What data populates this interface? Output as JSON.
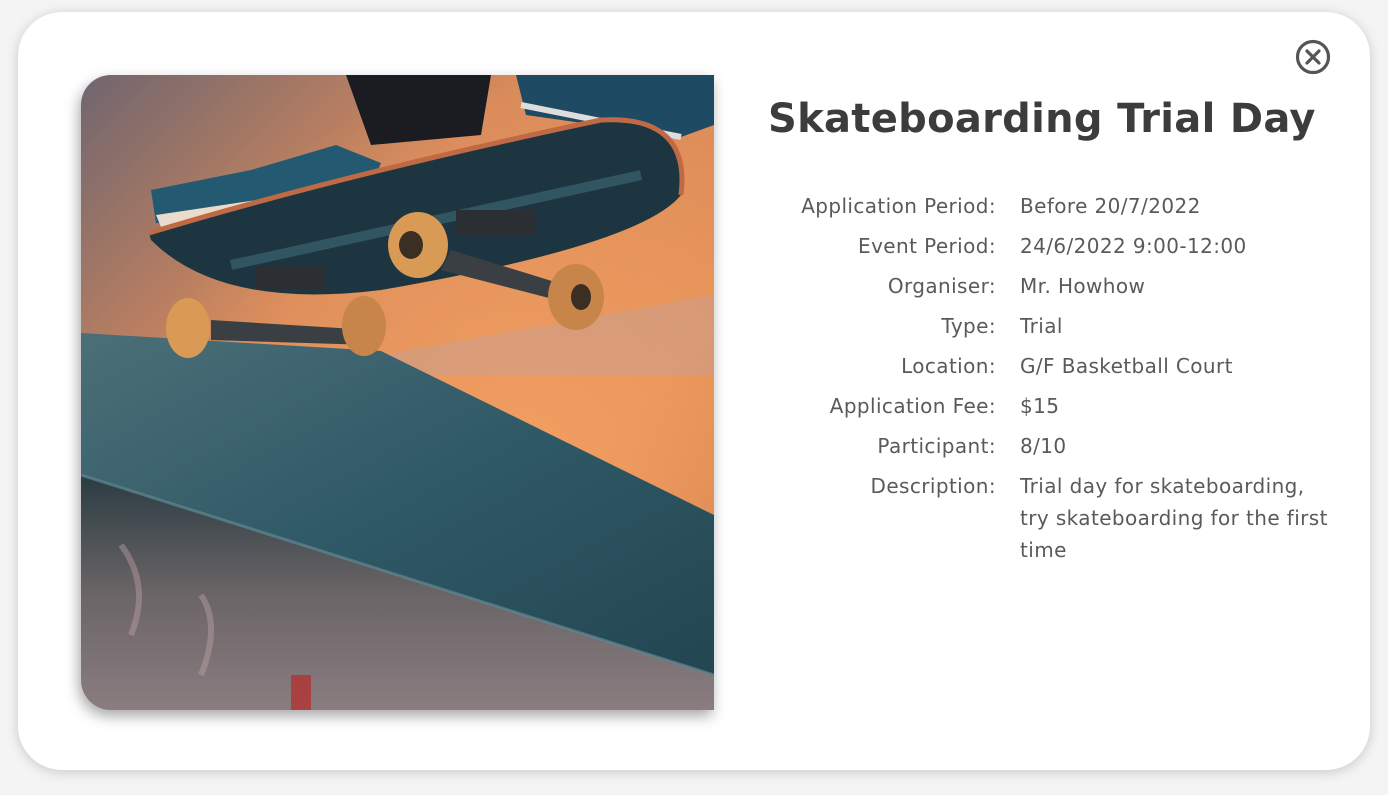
{
  "event": {
    "title": "Skateboarding Trial Day",
    "image_alt": "Skateboarder grinding a concrete ledge at sunset"
  },
  "details": [
    {
      "label": "Application Period:",
      "value": "Before 20/7/2022"
    },
    {
      "label": "Event Period:",
      "value": "24/6/2022 9:00-12:00"
    },
    {
      "label": "Organiser:",
      "value": "Mr. Howhow"
    },
    {
      "label": "Type:",
      "value": "Trial"
    },
    {
      "label": "Location:",
      "value": "G/F Basketball Court"
    },
    {
      "label": "Application Fee:",
      "value": "$15"
    },
    {
      "label": "Participant:",
      "value": "8/10"
    },
    {
      "label": "Description:",
      "value": "Trial day for skateboarding, try skateboarding for the first time"
    }
  ],
  "icons": {
    "close": "close-circle-icon"
  },
  "colors": {
    "title": "#3c3c3c",
    "text": "#5a5a5a",
    "close_icon": "#555555"
  }
}
